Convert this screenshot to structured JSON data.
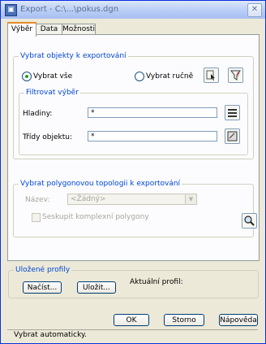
{
  "window": {
    "title": "Export - C:\\...\\pokus.dgn"
  },
  "tabs": [
    {
      "label": "Výběr"
    },
    {
      "label": "Data"
    },
    {
      "label": "Možnosti"
    }
  ],
  "select_objects": {
    "title": "Vybrat objekty k exportování",
    "select_all": "Vybrat vše",
    "select_manual": "Vybrat ručně",
    "selected_option": "Vybrat vše"
  },
  "filter": {
    "title": "Filtrovat výběr",
    "layers_label": "Hladiny:",
    "layers_value": "*",
    "classes_label": "Třídy objektu:",
    "classes_value": "*"
  },
  "topology": {
    "title": "Vybrat polygonovou topologii k exportování",
    "name_label": "Název:",
    "name_value": "<Žádný>",
    "group_label": "Seskupit komplexní polygony"
  },
  "profiles": {
    "title": "Uložené profily",
    "load": "Načíst...",
    "save": "Uložit...",
    "current_label": "Aktuální profil:"
  },
  "buttons": {
    "ok": "OK",
    "cancel": "Storno",
    "help": "Nápověda"
  },
  "status": "Vybrat automaticky."
}
